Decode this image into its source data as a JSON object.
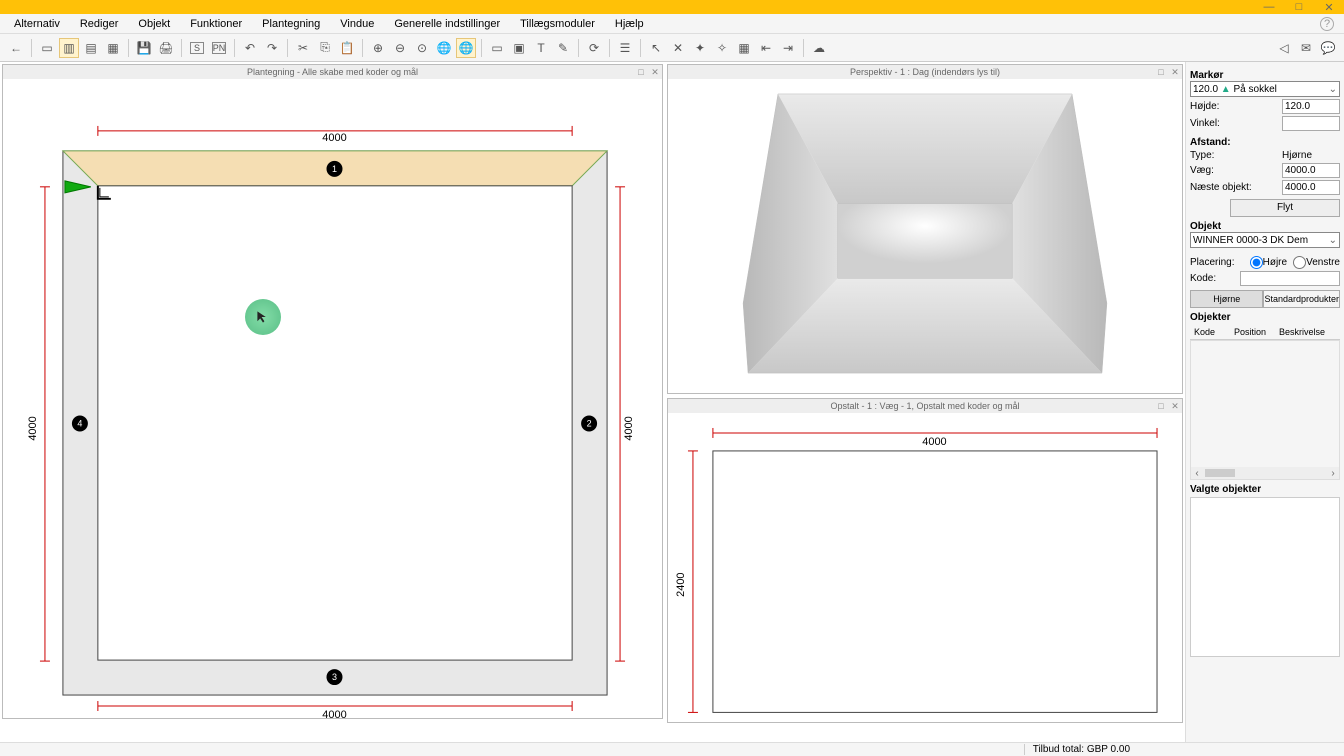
{
  "menu": [
    "Alternativ",
    "Rediger",
    "Objekt",
    "Funktioner",
    "Plantegning",
    "Vindue",
    "Generelle indstillinger",
    "Tillægsmoduler",
    "Hjælp"
  ],
  "toolbar_letters": {
    "s": "S",
    "pn": "PN"
  },
  "subwin": {
    "plan_title": "Plantegning - Alle skabe med koder og mål",
    "persp_title": "Perspektiv - 1 : Dag (indendørs lys til)",
    "elev_title": "Opstalt - 1 : Væg - 1, Opstalt med koder og mål"
  },
  "plan": {
    "dim_top": "4000",
    "dim_bottom": "4000",
    "dim_left": "4000",
    "dim_right": "4000",
    "walls": [
      "1",
      "2",
      "3",
      "4"
    ]
  },
  "elev": {
    "dim_top": "4000",
    "dim_left": "2400"
  },
  "panel": {
    "markor_label": "Markør",
    "markor_val": "120.0",
    "markor_sokkel": "På sokkel",
    "hojde_label": "Højde:",
    "hojde_val": "120.0",
    "vinkel_label": "Vinkel:",
    "vinkel_val": "",
    "afstand_label": "Afstand:",
    "type_label": "Type:",
    "type_val": "Hjørne",
    "vaeg_label": "Væg:",
    "vaeg_val": "4000.0",
    "naeste_label": "Næste objekt:",
    "naeste_val": "4000.0",
    "flyt_btn": "Flyt",
    "objekt_label": "Objekt",
    "objekt_val": "WINNER 0000-3 DK Dem",
    "placering_label": "Placering:",
    "plac_hojre": "Højre",
    "plac_venstre": "Venstre",
    "kode_label": "Kode:",
    "tab_hjorne": "Hjørne",
    "tab_std": "Standardprodukter",
    "objekter_label": "Objekter",
    "col_kode": "Kode",
    "col_pos": "Position",
    "col_besk": "Beskrivelse",
    "valgte_label": "Valgte objekter"
  },
  "status": {
    "tilbud": "Tilbud total: GBP 0.00"
  }
}
